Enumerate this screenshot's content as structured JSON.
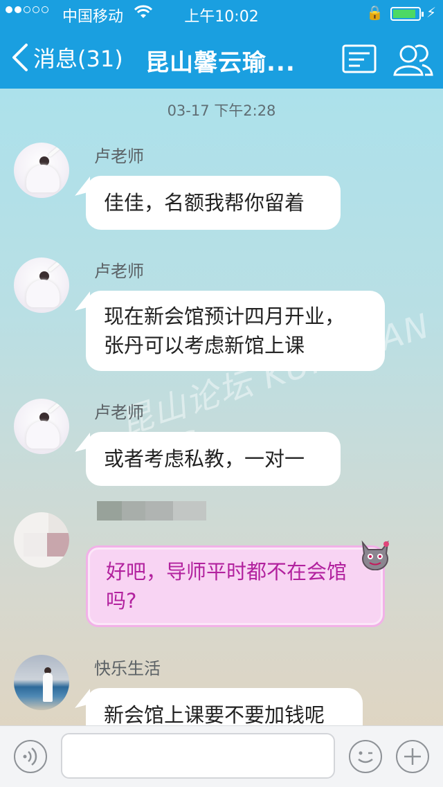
{
  "status_bar": {
    "carrier": "中国移动",
    "time": "上午10:02"
  },
  "nav": {
    "back_label": "消息(31)",
    "title": "昆山馨云瑜..."
  },
  "chat": {
    "timestamp": "03-17 下午2:28",
    "messages": [
      {
        "sender": "卢老师",
        "lines": [
          "佳佳，名额我帮你留着"
        ]
      },
      {
        "sender": "卢老师",
        "lines": [
          "现在新会馆预计四月开业，",
          "张丹可以考虑新馆上课"
        ]
      },
      {
        "sender": "卢老师",
        "lines": [
          "或者考虑私教，一对一"
        ]
      },
      {
        "sender": "",
        "lines": [
          "好吧，导师平时都不在会馆",
          "吗?"
        ]
      },
      {
        "sender": "快乐生活",
        "lines": [
          "新会馆上课要不要加钱呢"
        ]
      }
    ]
  },
  "watermark": "昆山论坛 KUNSHAN BBS",
  "colors": {
    "nav_bg": "#1a9fe0",
    "pink_bubble_text": "#b2219e",
    "pink_bubble_bg": "#f8d4f3"
  },
  "icons": {
    "back": "chevron-left-icon",
    "doc": "document-icon",
    "group": "group-profile-icon",
    "voice": "voice-icon",
    "emoji": "emoji-icon",
    "plus": "plus-icon"
  }
}
